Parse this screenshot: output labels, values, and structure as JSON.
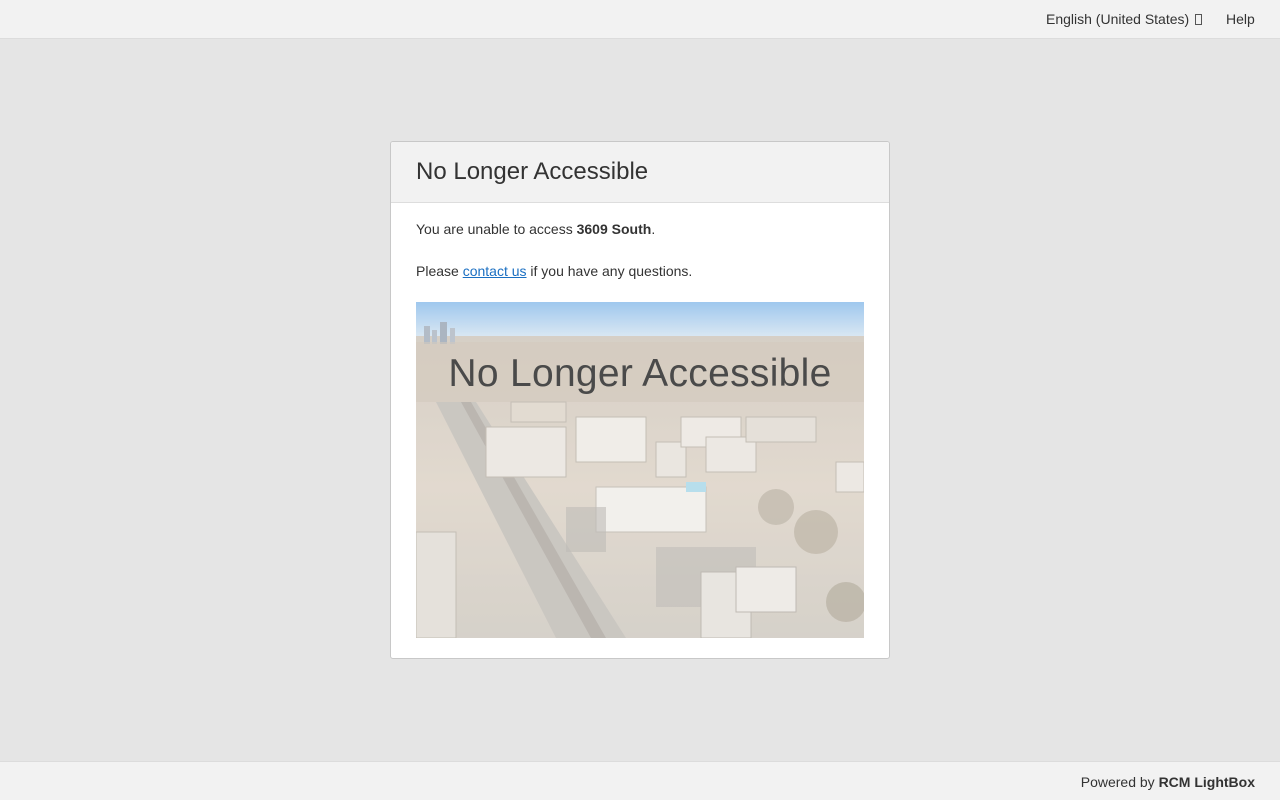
{
  "topbar": {
    "language": "English (United States)",
    "help": "Help"
  },
  "panel": {
    "title": "No Longer Accessible",
    "line1_prefix": "You are unable to access ",
    "property_name": "3609 South",
    "line1_suffix": ".",
    "line2_prefix": "Please ",
    "contact_link": "contact us",
    "line2_suffix": " if you have any questions.",
    "image_overlay_text": "No Longer Accessible"
  },
  "footer": {
    "powered_prefix": "Powered by ",
    "brand": "RCM LightBox"
  }
}
